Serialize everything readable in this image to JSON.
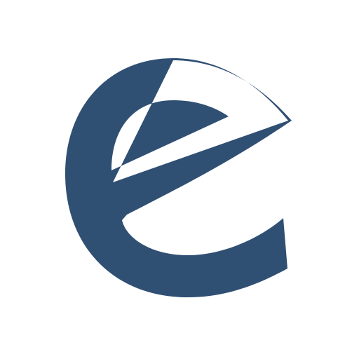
{
  "brand": {
    "logo_name": "e",
    "colors": {
      "logo": "#2f4f73",
      "background": "#ffffff"
    }
  }
}
